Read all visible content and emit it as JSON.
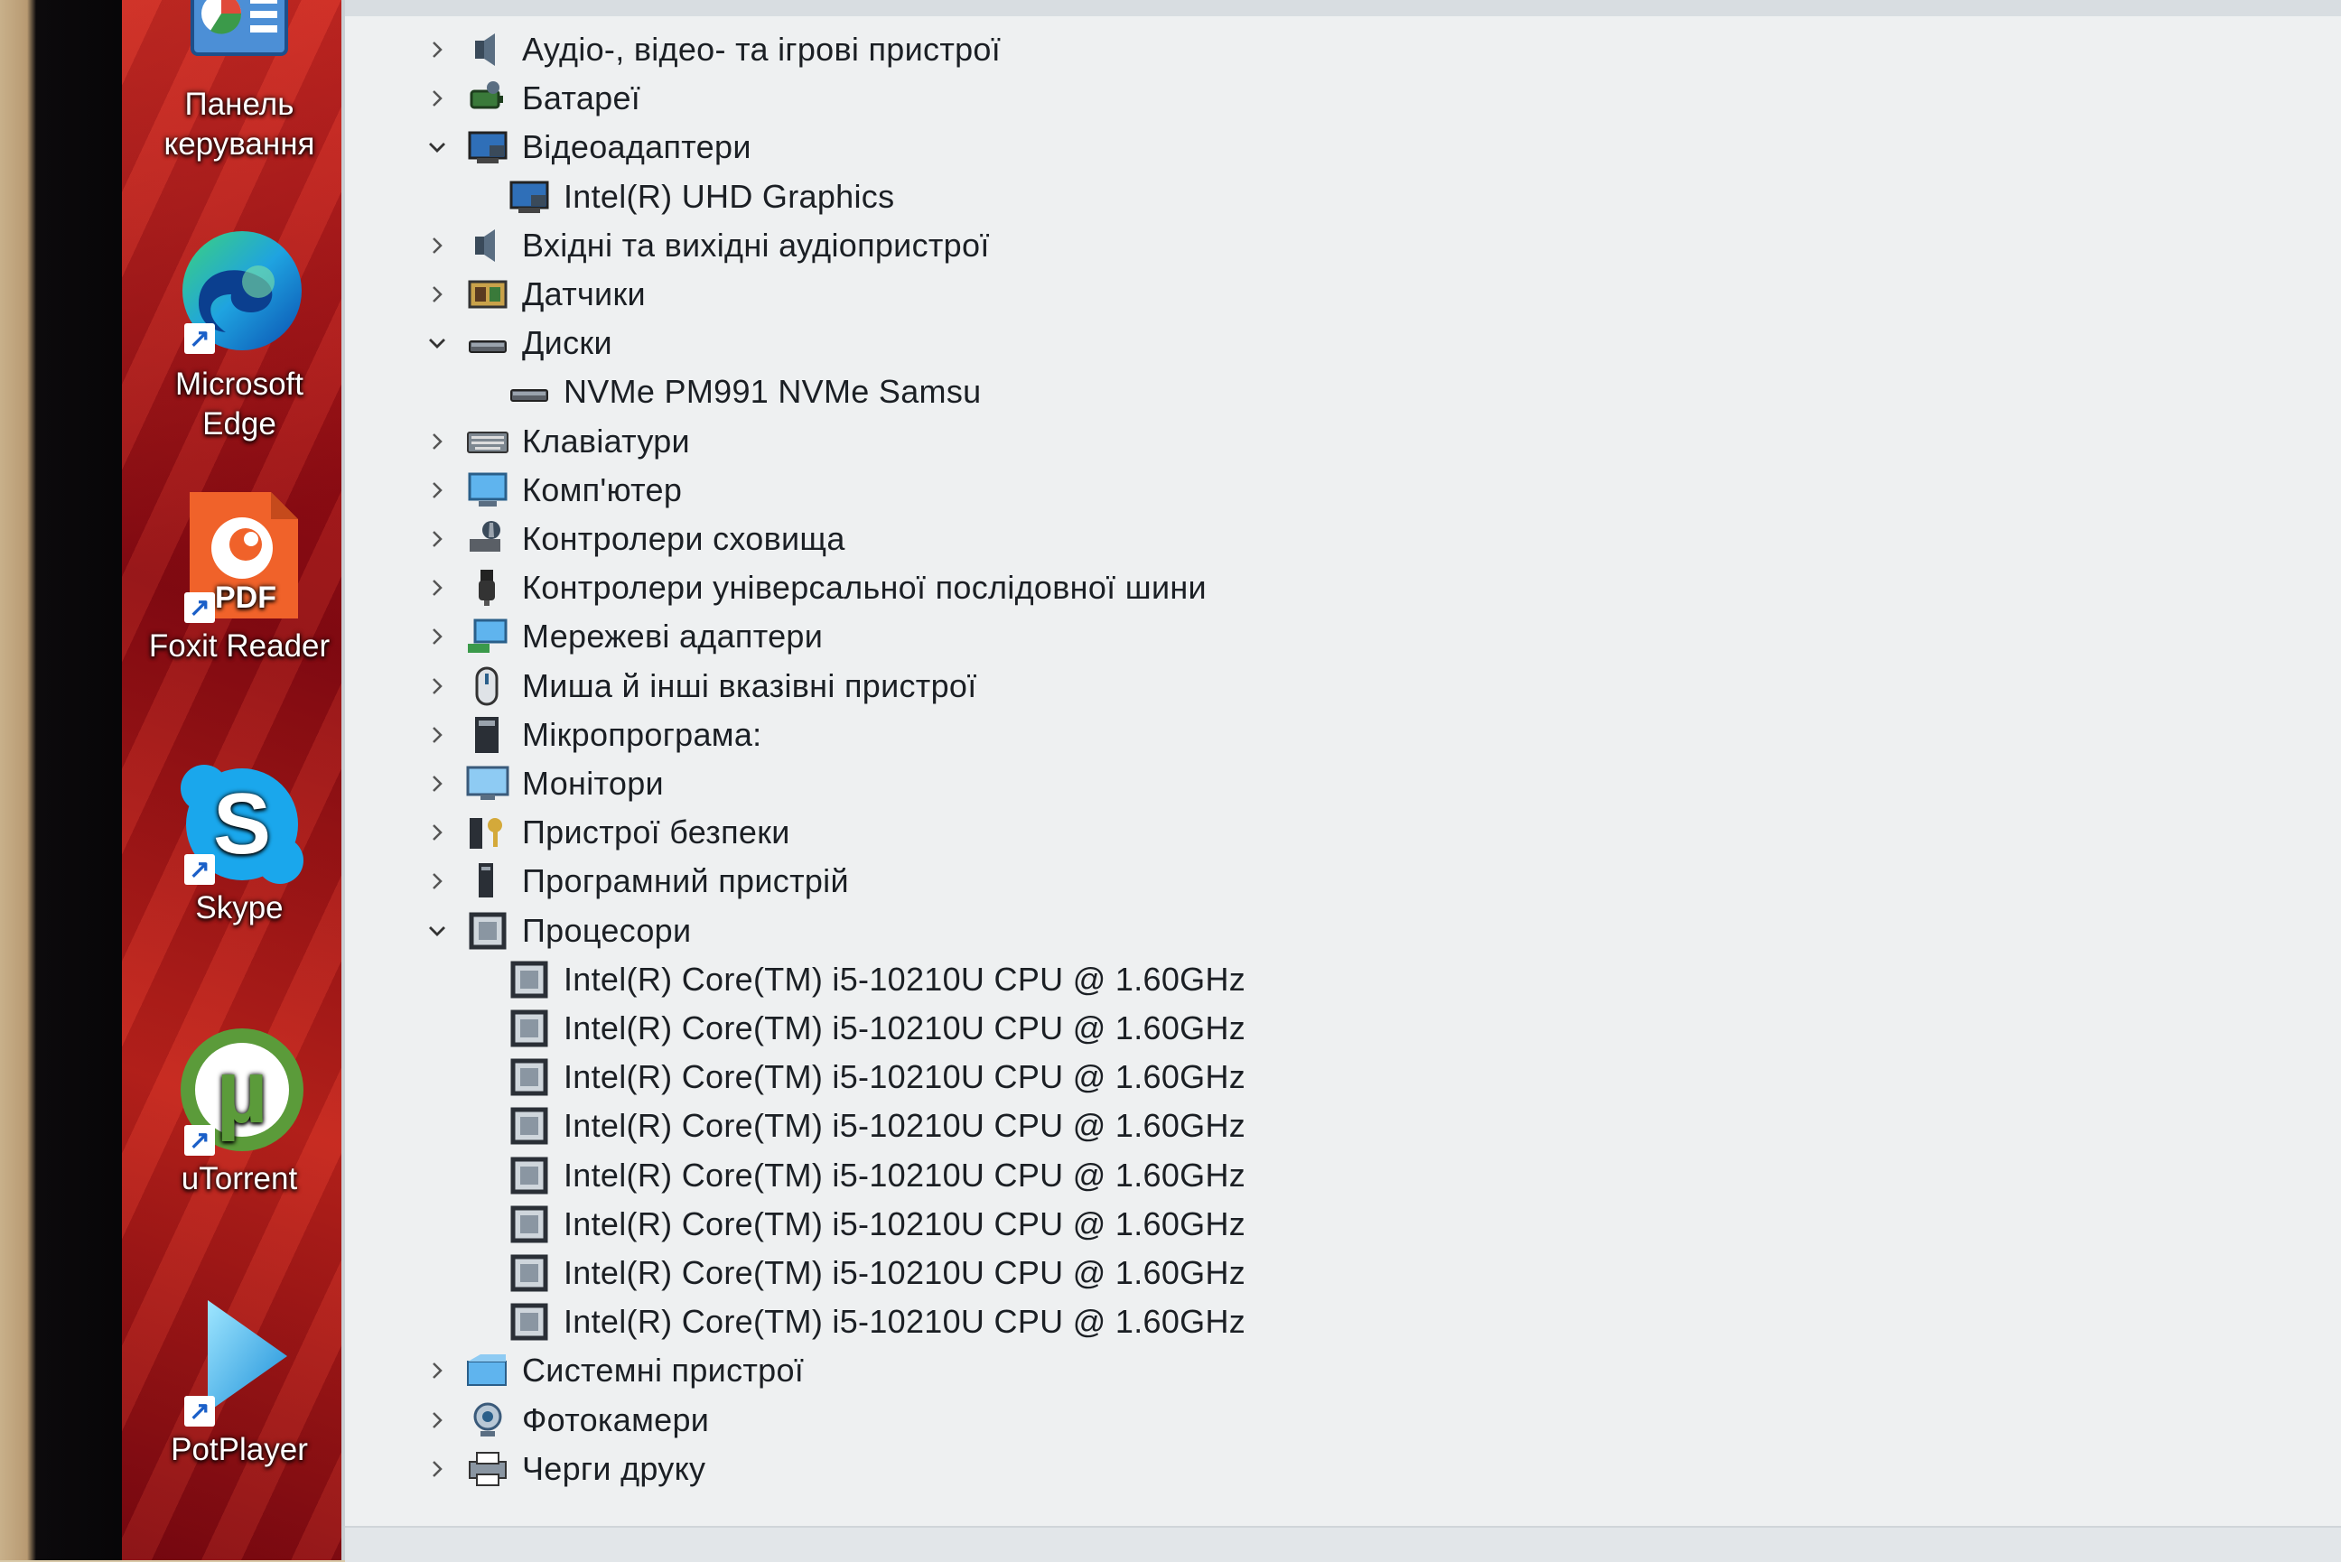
{
  "desktop": {
    "shortcuts": [
      {
        "label": "Панель\nкерування",
        "line1": "Панель",
        "line2": "керування",
        "icon": "control-panel-icon"
      },
      {
        "label": "Microsoft Edge",
        "line1": "Microsoft",
        "line2": "Edge",
        "icon": "edge-icon"
      },
      {
        "label": "Foxit Reader",
        "line1": "Foxit Reader",
        "line2": "",
        "icon": "foxit-pdf-icon"
      },
      {
        "label": "Skype",
        "line1": "Skype",
        "line2": "",
        "icon": "skype-icon"
      },
      {
        "label": "uTorrent",
        "line1": "uTorrent",
        "line2": "",
        "icon": "utorrent-icon"
      },
      {
        "label": "PotPlayer",
        "line1": "PotPlayer",
        "line2": "",
        "icon": "potplayer-icon"
      }
    ],
    "foxit_badge": "PDF"
  },
  "device_manager": {
    "tree": [
      {
        "label": "Аудіо-, відео- та ігрові пристрої",
        "expanded": false,
        "icon": "speaker-icon"
      },
      {
        "label": "Батареї",
        "expanded": false,
        "icon": "battery-icon"
      },
      {
        "label": "Відеоадаптери",
        "expanded": true,
        "icon": "display-adapter-icon",
        "children": [
          "Intel(R) UHD Graphics"
        ]
      },
      {
        "label": "Вхідні та вихідні аудіопристрої",
        "expanded": false,
        "icon": "speaker-icon"
      },
      {
        "label": "Датчики",
        "expanded": false,
        "icon": "sensor-icon"
      },
      {
        "label": "Диски",
        "expanded": true,
        "icon": "disk-drive-icon",
        "children": [
          "NVMe PM991 NVMe Samsu"
        ]
      },
      {
        "label": "Клавіатури",
        "expanded": false,
        "icon": "keyboard-icon"
      },
      {
        "label": "Комп'ютер",
        "expanded": false,
        "icon": "computer-icon"
      },
      {
        "label": "Контролери сховища",
        "expanded": false,
        "icon": "storage-controller-icon"
      },
      {
        "label": "Контролери універсальної послідовної шини",
        "expanded": false,
        "icon": "usb-icon"
      },
      {
        "label": "Мережеві адаптери",
        "expanded": false,
        "icon": "network-adapter-icon"
      },
      {
        "label": "Миша й інші вказівні пристрої",
        "expanded": false,
        "icon": "mouse-icon"
      },
      {
        "label": "Мікропрограма:",
        "expanded": false,
        "icon": "firmware-icon"
      },
      {
        "label": "Монітори",
        "expanded": false,
        "icon": "monitor-icon"
      },
      {
        "label": "Пристрої безпеки",
        "expanded": false,
        "icon": "security-device-icon"
      },
      {
        "label": "Програмний пристрій",
        "expanded": false,
        "icon": "software-device-icon"
      },
      {
        "label": "Процесори",
        "expanded": true,
        "icon": "processor-icon",
        "children": [
          "Intel(R) Core(TM) i5-10210U CPU @ 1.60GHz",
          "Intel(R) Core(TM) i5-10210U CPU @ 1.60GHz",
          "Intel(R) Core(TM) i5-10210U CPU @ 1.60GHz",
          "Intel(R) Core(TM) i5-10210U CPU @ 1.60GHz",
          "Intel(R) Core(TM) i5-10210U CPU @ 1.60GHz",
          "Intel(R) Core(TM) i5-10210U CPU @ 1.60GHz",
          "Intel(R) Core(TM) i5-10210U CPU @ 1.60GHz",
          "Intel(R) Core(TM) i5-10210U CPU @ 1.60GHz"
        ]
      },
      {
        "label": "Системні пристрої",
        "expanded": false,
        "icon": "system-device-icon"
      },
      {
        "label": "Фотокамери",
        "expanded": false,
        "icon": "camera-icon"
      },
      {
        "label": "Черги друку",
        "expanded": false,
        "icon": "printer-icon"
      }
    ]
  },
  "colors": {
    "wallpaper": "#b31218",
    "window_bg": "#eef0f1",
    "text": "#1b1f24",
    "chevron": "#555555"
  }
}
